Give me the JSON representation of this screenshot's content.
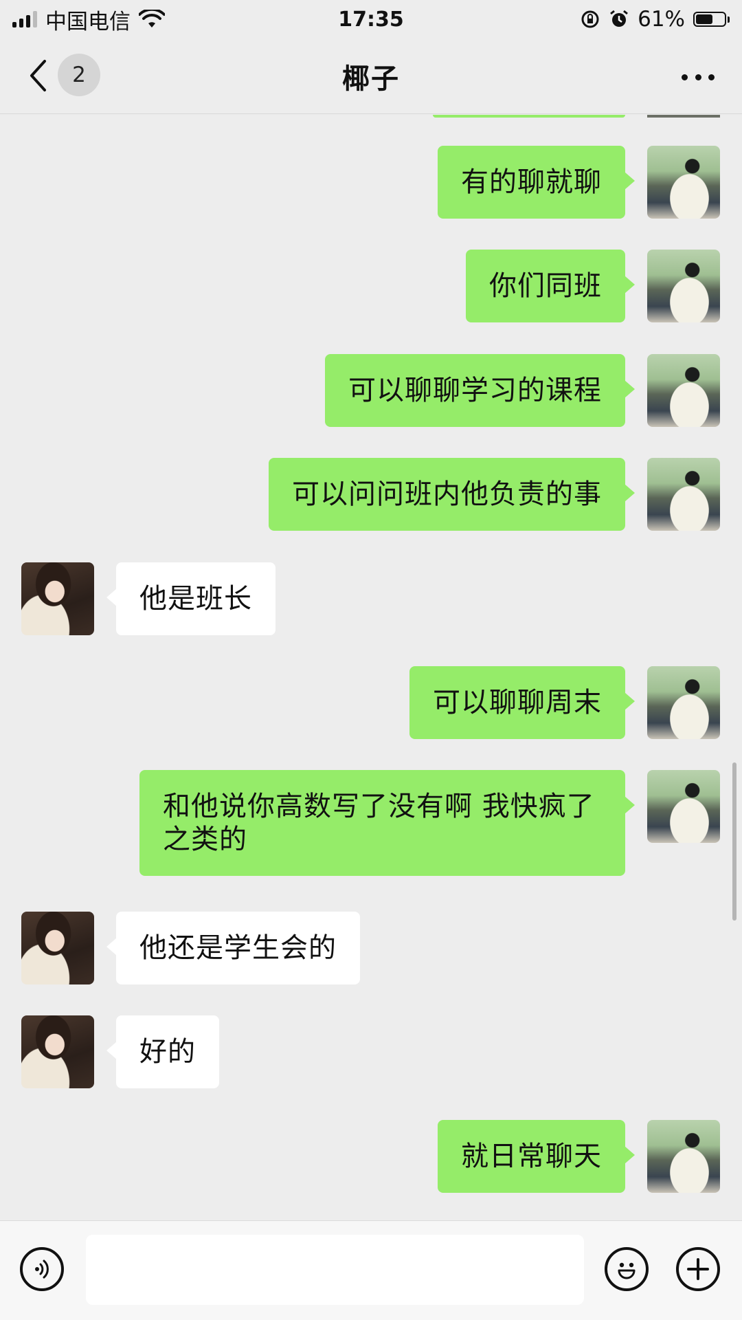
{
  "status_bar": {
    "carrier": "中国电信",
    "time": "17:35",
    "battery_percent": "61%",
    "icons": [
      "signal-icon",
      "wifi-icon",
      "rotation-lock-icon",
      "alarm-icon",
      "battery-icon"
    ]
  },
  "nav": {
    "title": "椰子",
    "unread_count": "2"
  },
  "messages": [
    {
      "side": "sent",
      "text": "有的聊就聊"
    },
    {
      "side": "sent",
      "text": "你们同班"
    },
    {
      "side": "sent",
      "text": "可以聊聊学习的课程"
    },
    {
      "side": "sent",
      "text": "可以问问班内他负责的事"
    },
    {
      "side": "received",
      "text": "他是班长"
    },
    {
      "side": "sent",
      "text": "可以聊聊周末"
    },
    {
      "side": "sent",
      "text": "和他说你高数写了没有啊 我快疯了 之类的"
    },
    {
      "side": "received",
      "text": "他还是学生会的"
    },
    {
      "side": "received",
      "text": "好的"
    },
    {
      "side": "sent",
      "text": "就日常聊天"
    }
  ],
  "input": {
    "placeholder": ""
  },
  "colors": {
    "background": "#ededed",
    "sent_bubble": "#95ec69",
    "received_bubble": "#ffffff"
  }
}
